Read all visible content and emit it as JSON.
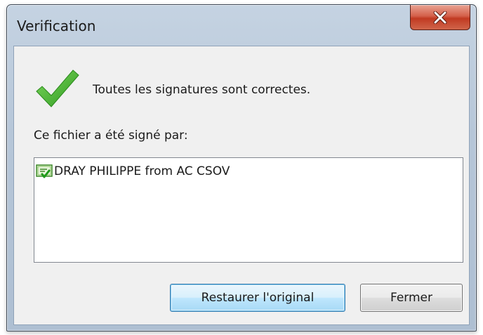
{
  "window": {
    "title": "Verification"
  },
  "icons": {
    "close": "close-icon",
    "status": "checkmark-icon",
    "certificate": "certificate-icon"
  },
  "colors": {
    "check_green": "#3fae2a",
    "close_red": "#c9432c",
    "default_button_border": "#3c7fb1"
  },
  "main": {
    "status_text": "Toutes les signatures sont correctes.",
    "signed_by_label": "Ce fichier a été signé par:",
    "signers": [
      {
        "label": "DRAY PHILIPPE from AC CSOV"
      }
    ]
  },
  "buttons": {
    "restore_label": "Restaurer l'original",
    "close_label": "Fermer"
  }
}
